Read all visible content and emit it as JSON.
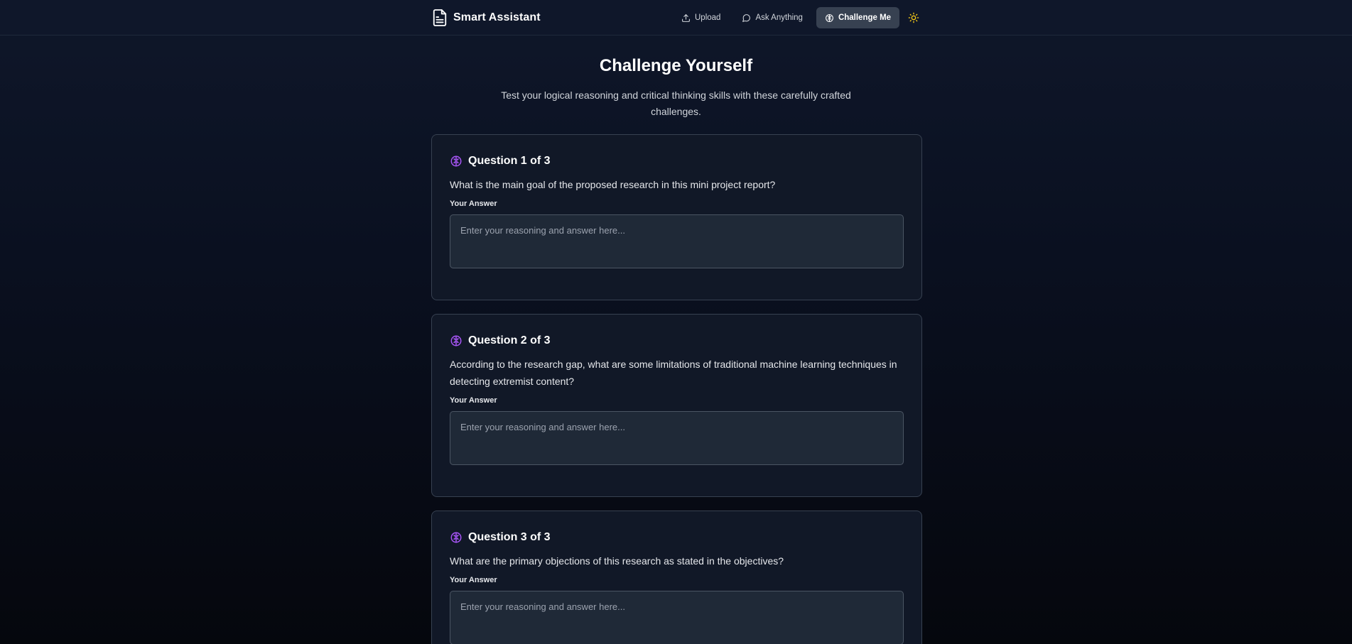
{
  "app": {
    "title": "Smart Assistant"
  },
  "nav": {
    "upload_label": "Upload",
    "ask_label": "Ask Anything",
    "challenge_label": "Challenge Me"
  },
  "header": {
    "title": "Challenge Yourself",
    "subtitle": "Test your logical reasoning and critical thinking skills with these carefully crafted challenges."
  },
  "questions": [
    {
      "title": "Question 1 of 3",
      "text": "What is the main goal of the proposed research in this mini project report?",
      "answer_label": "Your Answer",
      "placeholder": "Enter your reasoning and answer here..."
    },
    {
      "title": "Question 2 of 3",
      "text": "According to the research gap, what are some limitations of traditional machine learning techniques in detecting extremist content?",
      "answer_label": "Your Answer",
      "placeholder": "Enter your reasoning and answer here..."
    },
    {
      "title": "Question 3 of 3",
      "text": "What are the primary objections of this research as stated in the objectives?",
      "answer_label": "Your Answer",
      "placeholder": "Enter your reasoning and answer here..."
    }
  ],
  "colors": {
    "accent_purple": "#a855f7",
    "sun_yellow": "#facc15",
    "active_nav_bg": "#374151"
  },
  "icons": {
    "brand": "document-icon",
    "upload": "upload-icon",
    "ask": "chat-bubble-icon",
    "challenge": "brain-icon",
    "theme": "sun-icon",
    "question": "brain-icon"
  }
}
